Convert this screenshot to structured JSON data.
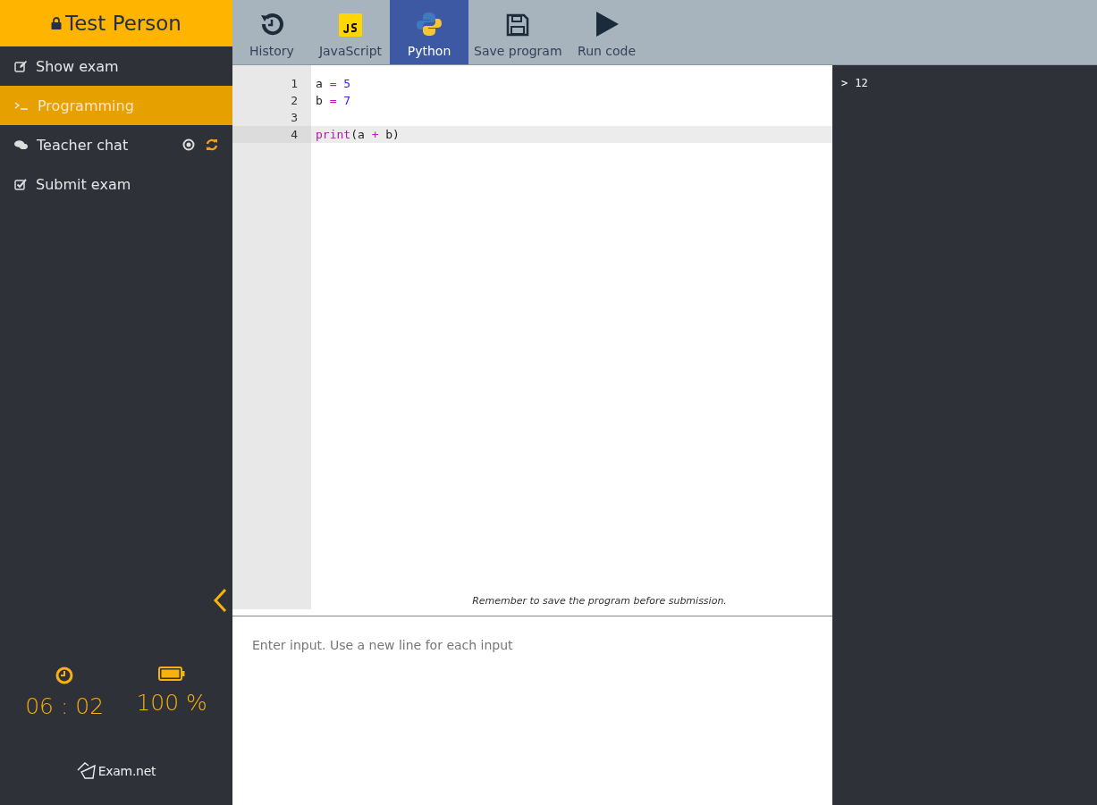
{
  "user": {
    "name": "Test Person"
  },
  "sidebar": {
    "items": [
      {
        "label": "Show exam",
        "kind": "edit",
        "selected": false
      },
      {
        "label": "Programming",
        "kind": "terminal",
        "selected": true
      },
      {
        "label": "Teacher chat",
        "kind": "chat",
        "selected": false,
        "extras": true
      },
      {
        "label": "Submit exam",
        "kind": "check",
        "selected": false
      }
    ]
  },
  "timer": "06 : 02",
  "battery": "100 %",
  "logo": "Exam.net",
  "toolbar": [
    {
      "label": "History",
      "kind": "history",
      "selected": false
    },
    {
      "label": "JavaScript",
      "kind": "js",
      "selected": false
    },
    {
      "label": "Python",
      "kind": "python",
      "selected": true
    },
    {
      "label": "Save program",
      "kind": "save",
      "selected": false
    },
    {
      "label": "Run code",
      "kind": "run",
      "selected": false
    }
  ],
  "editor": {
    "lines": [
      {
        "number": "1",
        "active": false,
        "tokens": [
          {
            "kind": "var",
            "text": "a "
          },
          {
            "kind": "op",
            "text": "="
          },
          {
            "kind": "num",
            "text": " 5"
          }
        ]
      },
      {
        "number": "2",
        "active": false,
        "tokens": [
          {
            "kind": "var",
            "text": "b "
          },
          {
            "kind": "op",
            "text": "="
          },
          {
            "kind": "num",
            "text": " 7"
          }
        ]
      },
      {
        "number": "3",
        "active": false
      },
      {
        "number": "4",
        "active": true,
        "tokens": [
          {
            "kind": "kw",
            "text": "print"
          },
          {
            "kind": "punc",
            "text": "(a "
          },
          {
            "kind": "op",
            "text": "+"
          },
          {
            "kind": "punc",
            "text": " b)"
          }
        ]
      }
    ],
    "hint": "Remember to save the program before submission."
  },
  "input": {
    "placeholder": "Enter input. Use a new line for each input"
  },
  "console": [
    {
      "prompt": ">",
      "text": "12"
    }
  ]
}
